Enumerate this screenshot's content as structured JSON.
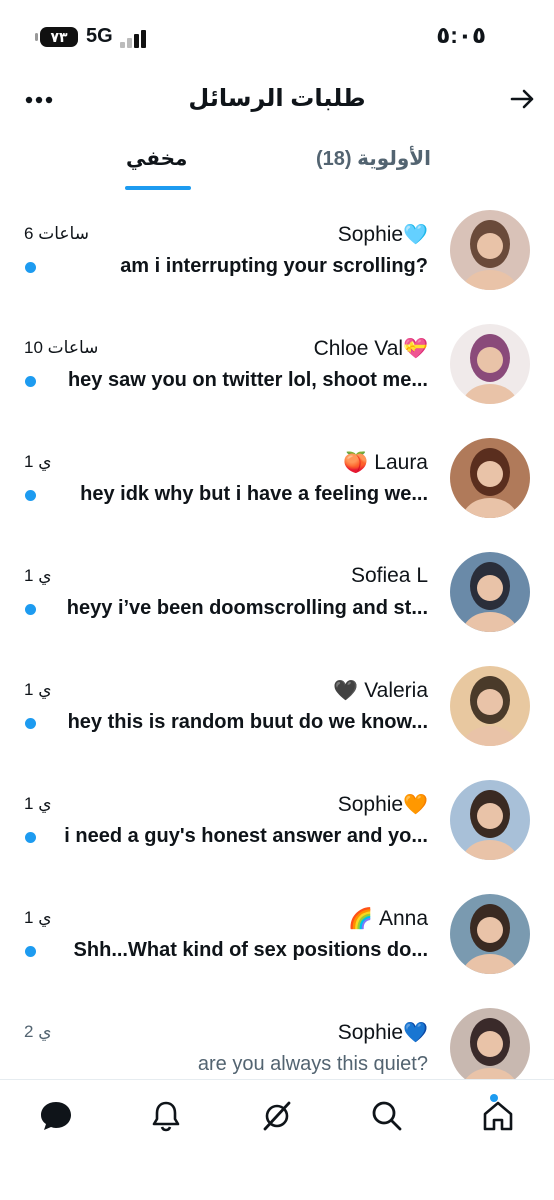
{
  "status_bar": {
    "time": "٥:٠٥",
    "network": "5G",
    "battery": "٧٣"
  },
  "header": {
    "title": "طلبات الرسائل"
  },
  "tabs": {
    "hidden": "مخفي",
    "priority": "الأولوية (18)"
  },
  "messages": [
    {
      "name": "Sophie",
      "emoji": "🩵",
      "time": "6 ساعات",
      "preview": "am i interrupting your scrolling?",
      "unread": true,
      "avatar_colors": [
        "#d9c2b8",
        "#6a4a3a"
      ]
    },
    {
      "name": "Chloe Val",
      "emoji": "💝",
      "time": "10 ساعات",
      "preview": "hey saw you on twitter lol, shoot me...",
      "unread": true,
      "avatar_colors": [
        "#f0eaea",
        "#8a4a7a"
      ]
    },
    {
      "name": "Laura",
      "emoji": "🍑",
      "time": "1 ي",
      "preview": "hey idk why but i have a feeling we...",
      "unread": true,
      "avatar_colors": [
        "#b07a5a",
        "#5a2e1e"
      ]
    },
    {
      "name": "Sofiea L",
      "emoji": "",
      "time": "1 ي",
      "preview": "heyy i’ve been doomscrolling and st...",
      "unread": true,
      "avatar_colors": [
        "#6a8aa8",
        "#2a2e3a"
      ]
    },
    {
      "name": "Valeria",
      "emoji": "🖤",
      "time": "1 ي",
      "preview": "hey this is random buut do we know...",
      "unread": true,
      "avatar_colors": [
        "#e8c8a0",
        "#4a3a2a"
      ]
    },
    {
      "name": "Sophie",
      "emoji": "🧡",
      "time": "1 ي",
      "preview": "i need a guy's honest answer and yo...",
      "unread": true,
      "avatar_colors": [
        "#a8c0d8",
        "#3a2a22"
      ]
    },
    {
      "name": "Anna",
      "emoji": "🌈",
      "time": "1 ي",
      "preview": "Shh...What kind of sex positions do...",
      "unread": true,
      "avatar_colors": [
        "#7a9ab0",
        "#3a2a22"
      ]
    },
    {
      "name": "Sophie",
      "emoji": "💙",
      "time": "2 ي",
      "preview": "are you always this quiet?",
      "unread": false,
      "avatar_colors": [
        "#c8b8b0",
        "#3a2a2a"
      ]
    }
  ],
  "icons": {
    "more": "more-icon",
    "back": "arrow-right-icon",
    "nav": [
      "messages-icon",
      "notifications-icon",
      "grok-icon",
      "search-icon",
      "home-icon"
    ]
  },
  "colors": {
    "accent": "#1d9bf0",
    "text": "#0f1419",
    "muted": "#536471"
  }
}
